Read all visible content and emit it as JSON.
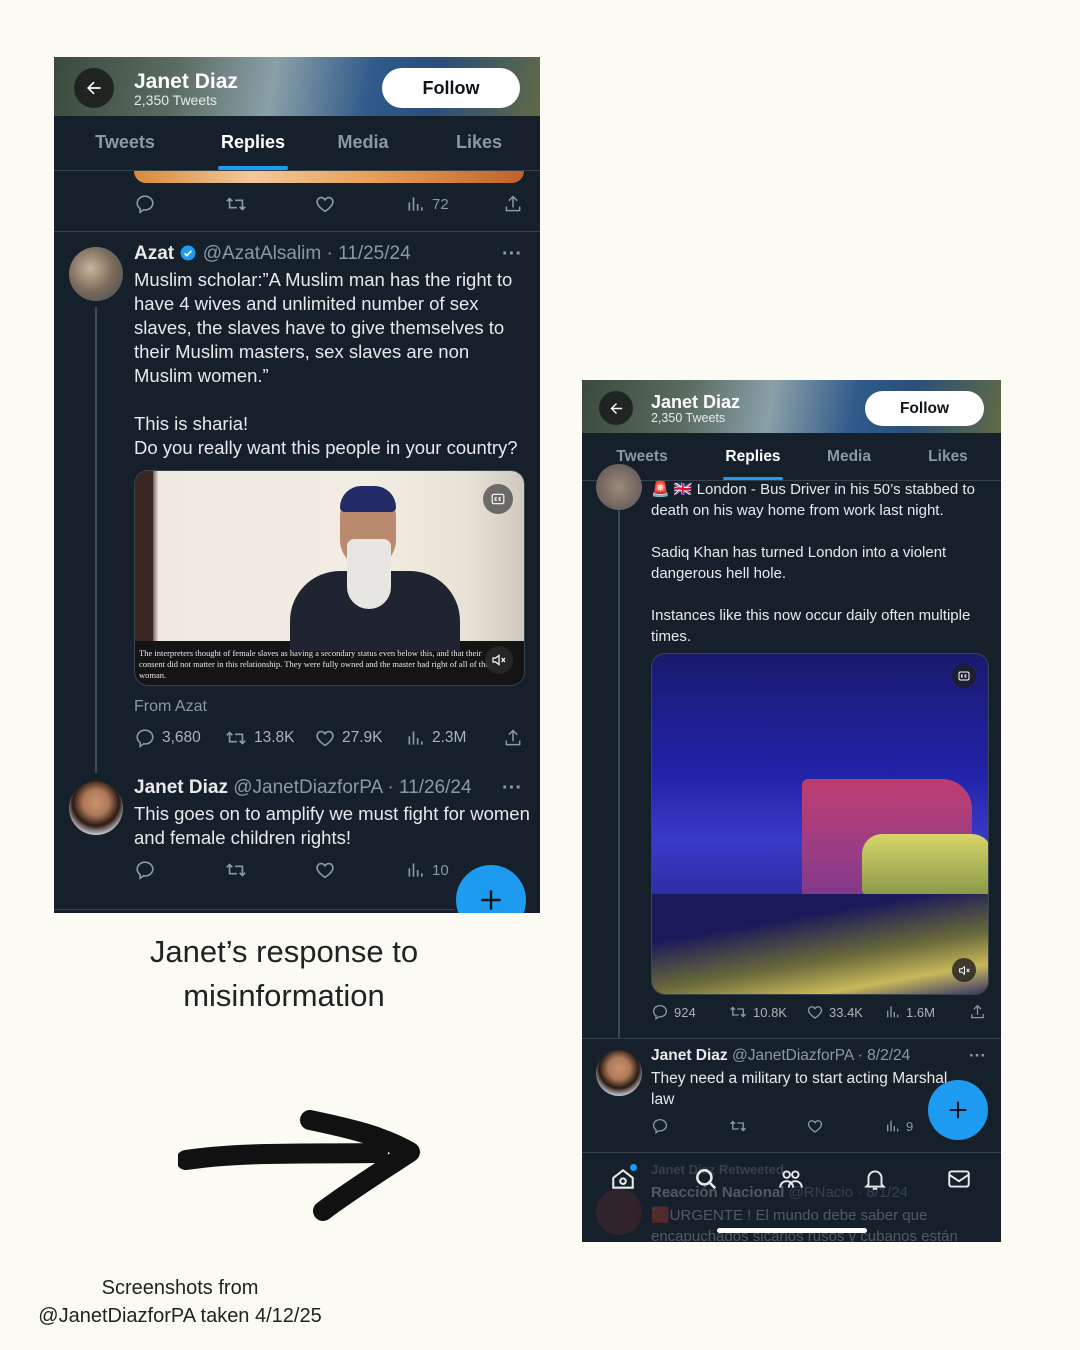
{
  "left": {
    "header": {
      "name": "Janet Diaz",
      "count": "2,350 Tweets",
      "follow_label": "Follow"
    },
    "tabs": [
      {
        "label": "Tweets"
      },
      {
        "label": "Replies"
      },
      {
        "label": "Media"
      },
      {
        "label": "Likes"
      }
    ],
    "top_stats": {
      "views": "72"
    },
    "tweet1": {
      "name": "Azat",
      "handle_date": "@AzatAlsalim · 11/25/24",
      "text": "Muslim scholar:”A Muslim man has the right to have 4 wives and unlimited number of sex slaves, the slaves have to give themselves to their Muslim masters, sex slaves are non Muslim women.”\n\nThis is sharia!\nDo you really want this people in your country?",
      "subtitle": "The interpreters thought of female slaves as having a secondary status even below this, and that their consent did not matter in this relationship. They were fully owned and the master had right of all of the woman.",
      "from": "From Azat",
      "stats": {
        "replies": "3,680",
        "retweets": "13.8K",
        "likes": "27.9K",
        "views": "2.3M"
      }
    },
    "tweet2": {
      "name": "Janet Diaz",
      "handle_date": "@JanetDiazforPA · 11/26/24",
      "text": "This goes on to amplify we must fight for women and female children rights!",
      "stats": {
        "views": "10"
      }
    }
  },
  "right": {
    "header": {
      "name": "Janet Diaz",
      "count": "2,350 Tweets",
      "follow_label": "Follow"
    },
    "tabs": [
      {
        "label": "Tweets"
      },
      {
        "label": "Replies"
      },
      {
        "label": "Media"
      },
      {
        "label": "Likes"
      }
    ],
    "tweet1": {
      "text": "🚨 🇬🇧 London - Bus Driver in his 50’s stabbed to death on his way home from work last night.\n\nSadiq Khan has turned London into a violent dangerous hell hole.\n\nInstances like this now occur daily often multiple times.",
      "stats": {
        "replies": "924",
        "retweets": "10.8K",
        "likes": "33.4K",
        "views": "1.6M"
      }
    },
    "tweet2": {
      "name": "Janet Diaz",
      "handle_date": "@JanetDiazforPA · 8/2/24",
      "text": "They need a military to start acting Marshal law",
      "stats": {
        "views": "9"
      }
    },
    "faded": {
      "retweet_label": "Janet Diaz Retweeted",
      "name": "Reacción Nacional",
      "handle_date": "@RNacio · 8/1/24",
      "text": "🟥URGENTE ! El mundo debe saber que encapuchados sicarios rusos y cubanos están"
    }
  },
  "caption": "Janet’s response to\nmisinformation",
  "source": "Screenshots from\n@JanetDiazforPA taken 4/12/25",
  "colors": {
    "accent": "#1d9bf0",
    "background": "#15202b",
    "page": "#fbfbf4"
  }
}
